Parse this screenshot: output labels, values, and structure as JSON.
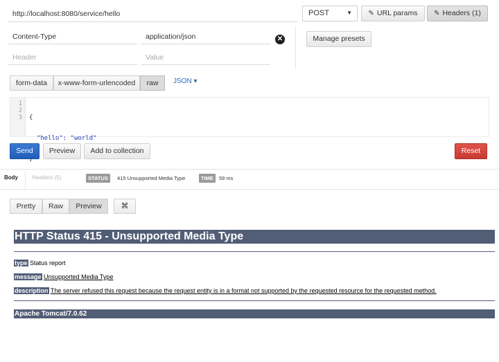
{
  "request": {
    "url": "http://localhost:8080/service/hello",
    "method": "POST",
    "url_params_label": "URL params",
    "headers_label": "Headers (1)",
    "headers": [
      {
        "key": "Content-Type",
        "value": "application/json"
      }
    ],
    "header_placeholder": "Header",
    "value_placeholder": "Value",
    "manage_presets_label": "Manage presets",
    "body_tabs": [
      "form-data",
      "x-www-form-urlencoded",
      "raw"
    ],
    "active_body_tab": "raw",
    "body_format": "JSON",
    "code_lines": [
      "{",
      "  \"hello\": \"world\"",
      "}"
    ],
    "line_numbers": [
      "1",
      "2",
      "3"
    ],
    "send_label": "Send",
    "preview_label": "Preview",
    "add_collection_label": "Add to collection",
    "reset_label": "Reset"
  },
  "response": {
    "tabs": [
      "Body",
      "Headers (5)"
    ],
    "status_badge": "STATUS",
    "status_text": "415 Unsupported Media Type",
    "time_badge": "TIME",
    "time_text": "59 ms",
    "view_modes": [
      "Pretty",
      "Raw",
      "Preview"
    ],
    "active_view": "Preview",
    "toggle_icon": "expand-icon"
  },
  "page": {
    "title": "HTTP Status 415 - Unsupported Media Type",
    "type_label": "type",
    "type_value": "Status report",
    "message_label": "message",
    "message_value": "Unsupported Media Type",
    "description_label": "description",
    "description_value": "The server refused this request because the request entity is in a format not supported by the requested resource for the requested method.",
    "footer": "Apache Tomcat/7.0.62"
  },
  "colors": {
    "send": "#1f5db8",
    "reset": "#c83a32",
    "tomcat_bar": "#525d76",
    "json_link": "#2a6ab8"
  }
}
